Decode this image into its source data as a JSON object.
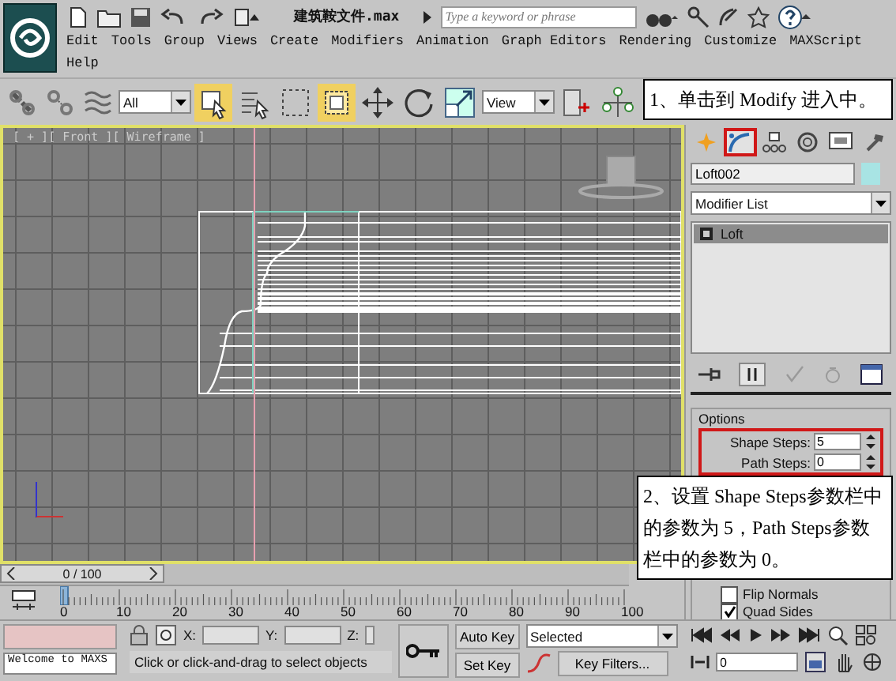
{
  "title_bar": {
    "filename": "建筑鞍文件.max",
    "search": {
      "placeholder": "Type a keyword or phrase"
    }
  },
  "menu": [
    "Edit",
    "Tools",
    "Group",
    "Views",
    "Create",
    "Modifiers",
    "Animation",
    "Graph Editors",
    "Rendering",
    "Customize",
    "MAXScript",
    "Help"
  ],
  "toolbar": {
    "selection_filter": "All",
    "reference_coord": "View"
  },
  "viewport": {
    "label": "[ + ][ Front ][ Wireframe ]"
  },
  "command_panel": {
    "tabs": [
      {
        "kind": "create",
        "selected": false,
        "highlighted": false
      },
      {
        "kind": "modify",
        "selected": true,
        "highlighted": true
      },
      {
        "kind": "hierarchy",
        "selected": false,
        "highlighted": false
      },
      {
        "kind": "motion",
        "selected": false,
        "highlighted": false
      },
      {
        "kind": "display",
        "selected": false,
        "highlighted": false
      },
      {
        "kind": "utilities",
        "selected": false,
        "highlighted": false
      }
    ],
    "object_name": "Loft002",
    "modifier_list": "Modifier List",
    "stack": [
      {
        "label": "Loft",
        "selected": true
      }
    ],
    "rollout": {
      "title": "Options",
      "highlighted": true,
      "spinners": [
        {
          "label": "Shape Steps:",
          "value": "5"
        },
        {
          "label": "Path Steps:",
          "value": "0"
        }
      ],
      "checkboxes": [
        {
          "label": "Flip Normals",
          "checked": false
        },
        {
          "label": "Quad Sides",
          "checked": true
        }
      ]
    }
  },
  "time_slider": {
    "label": "0 / 100",
    "level": 0
  },
  "track": {
    "ticks": [
      "0",
      "10",
      "20",
      "30",
      "40",
      "50",
      "60",
      "70",
      "80",
      "90",
      "100"
    ]
  },
  "status": {
    "welcome": "Welcome to MAXS",
    "coords": [
      "X:",
      "Y:",
      "Z:"
    ],
    "prompt": "Click or click-and-drag to select objects",
    "auto_key": "Auto Key",
    "set_key": "Set Key",
    "key_mode": "Selected",
    "key_filters": "Key Filters...",
    "frame": "0"
  },
  "callouts": [
    {
      "text": "1、单击到 Modify 进入中。"
    },
    {
      "text": "2、设置 Shape Steps参数栏中的参数为 5，Path Steps参数栏中的参数为 0。"
    }
  ]
}
